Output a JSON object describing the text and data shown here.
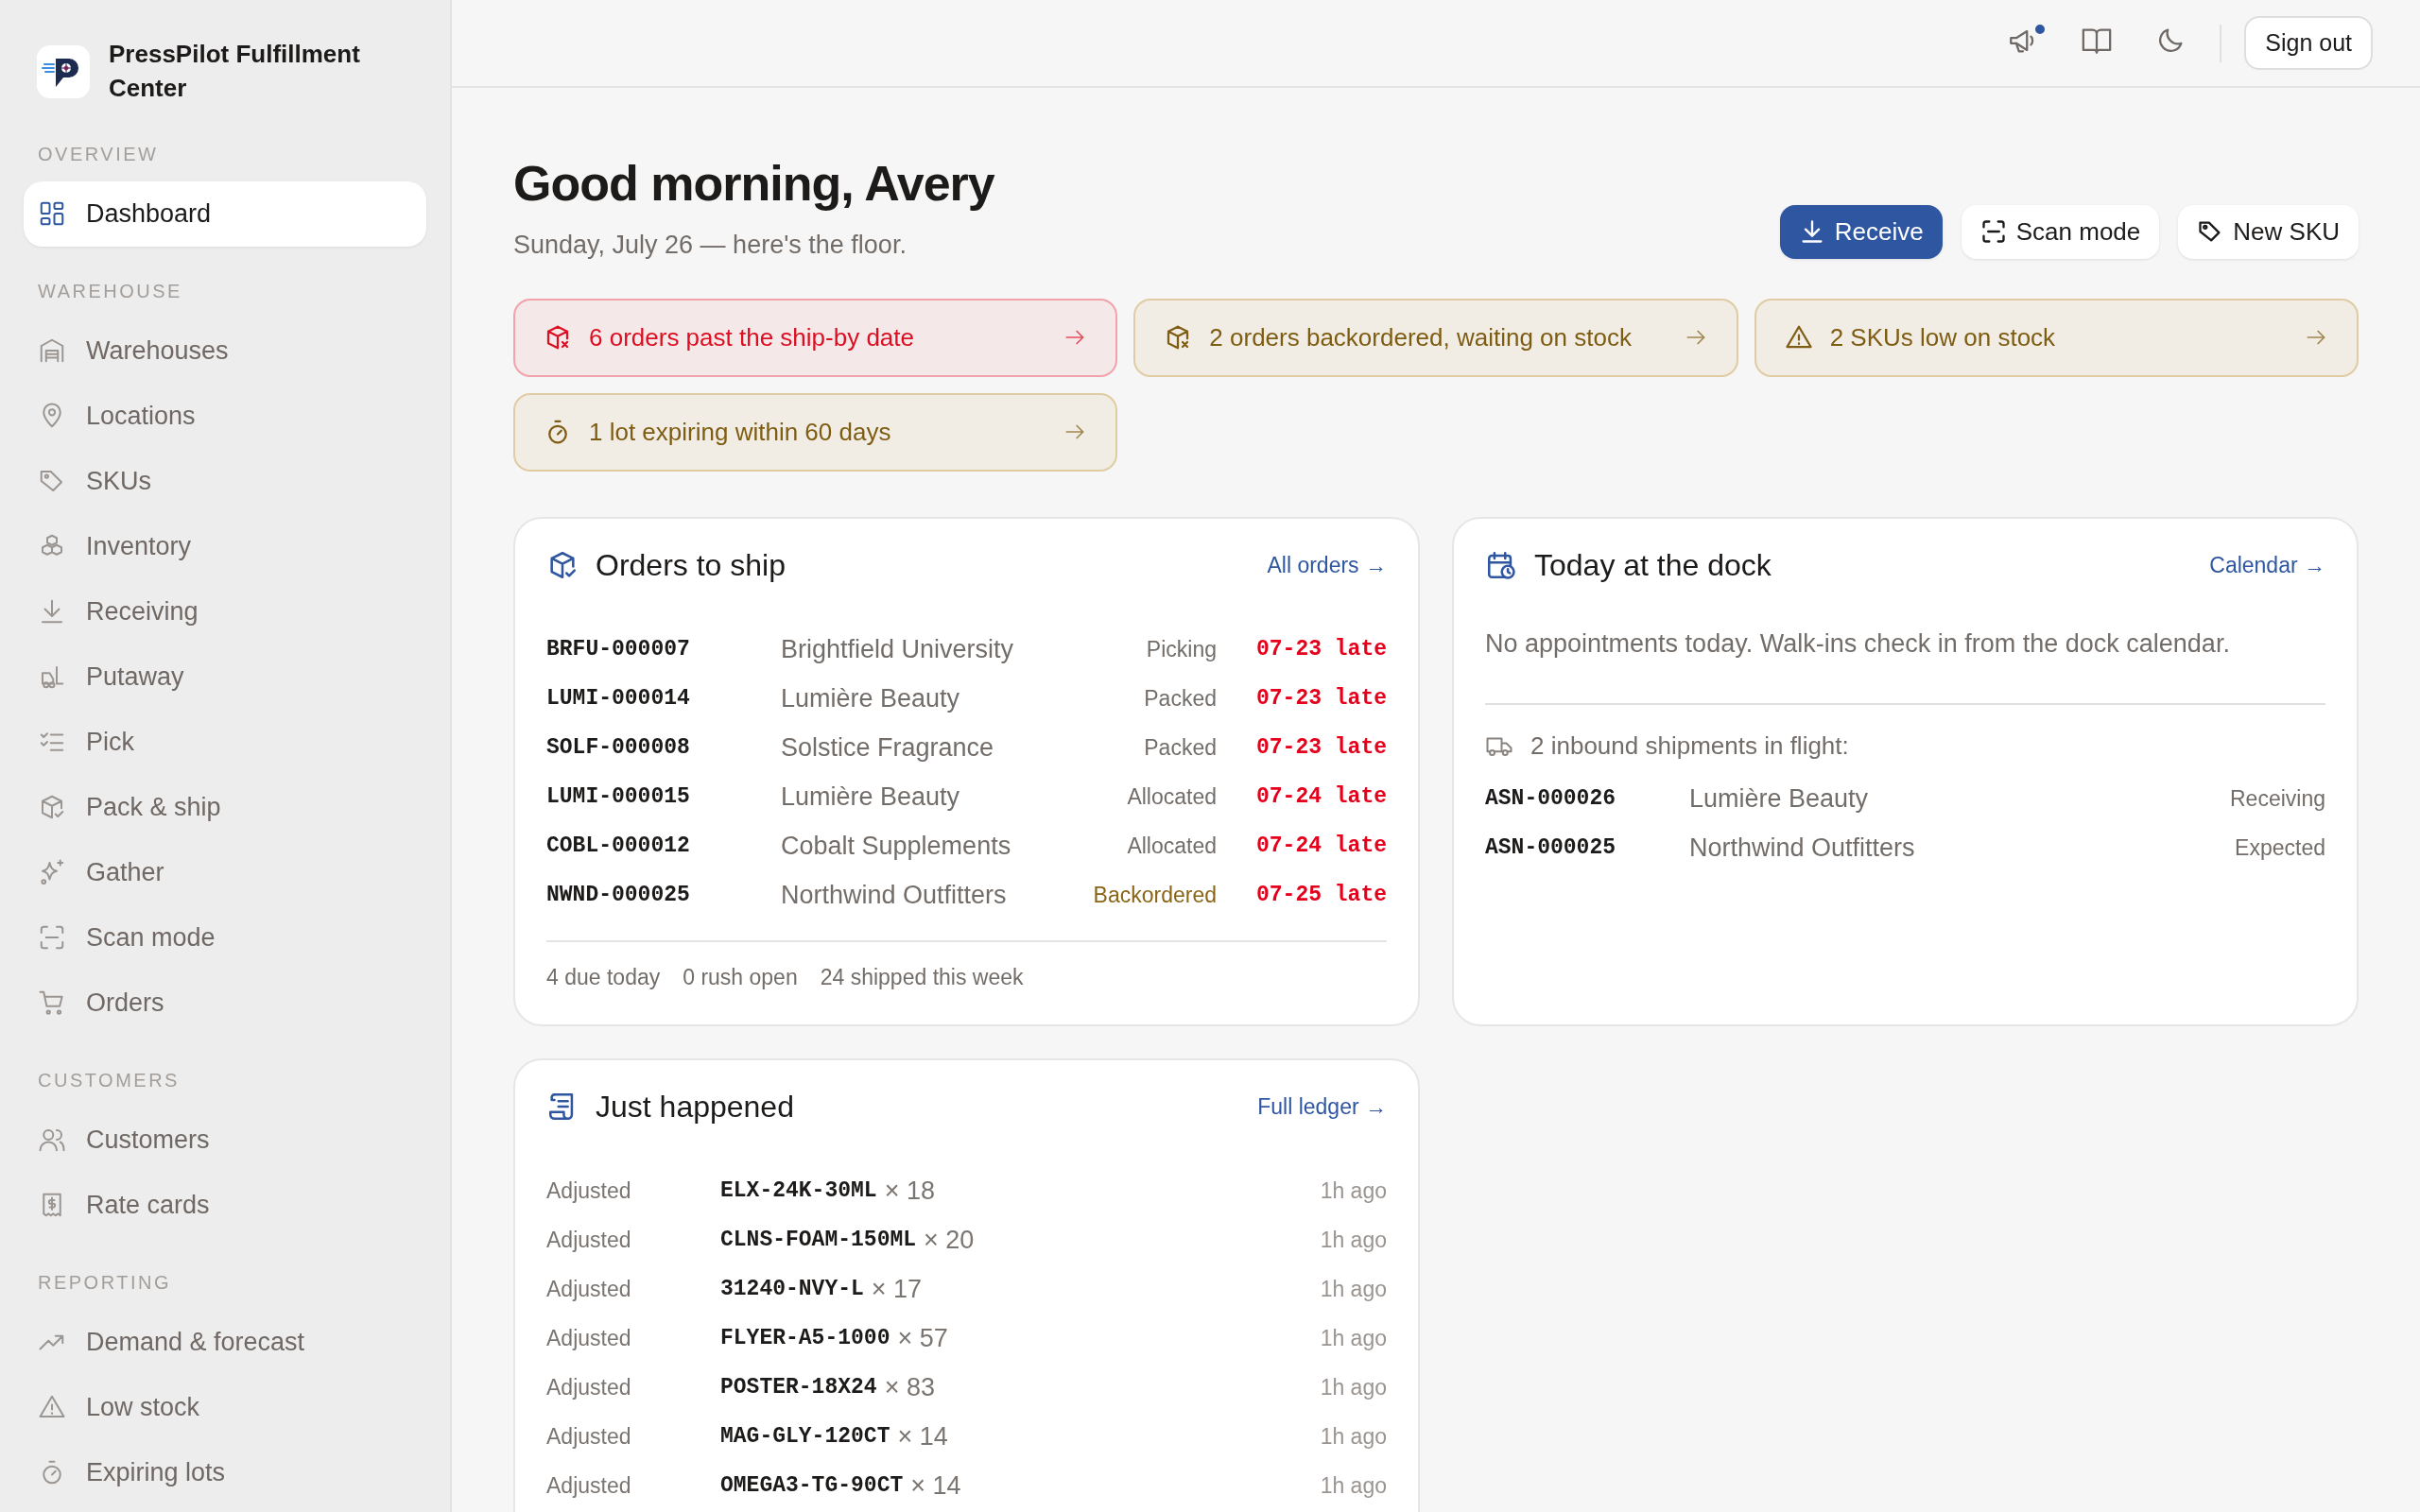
{
  "brand": {
    "name": "PressPilot Fulfillment Center"
  },
  "sidebar": {
    "sections": [
      {
        "label": "OVERVIEW",
        "items": [
          {
            "label": "Dashboard",
            "selected": true
          }
        ]
      },
      {
        "label": "WAREHOUSE",
        "items": [
          {
            "label": "Warehouses",
            "selected": false
          },
          {
            "label": "Locations",
            "selected": false
          },
          {
            "label": "SKUs",
            "selected": false
          },
          {
            "label": "Inventory",
            "selected": false
          },
          {
            "label": "Receiving",
            "selected": false
          },
          {
            "label": "Putaway",
            "selected": false
          },
          {
            "label": "Pick",
            "selected": false
          },
          {
            "label": "Pack & ship",
            "selected": false
          },
          {
            "label": "Gather",
            "selected": false
          },
          {
            "label": "Scan mode",
            "selected": false
          },
          {
            "label": "Orders",
            "selected": false
          }
        ]
      },
      {
        "label": "CUSTOMERS",
        "items": [
          {
            "label": "Customers",
            "selected": false
          },
          {
            "label": "Rate cards",
            "selected": false
          }
        ]
      },
      {
        "label": "REPORTING",
        "items": [
          {
            "label": "Demand & forecast",
            "selected": false
          },
          {
            "label": "Low stock",
            "selected": false
          },
          {
            "label": "Expiring lots",
            "selected": false
          }
        ]
      }
    ]
  },
  "topbar": {
    "announcements_unread": true,
    "sign_out": "Sign out"
  },
  "header": {
    "title": "Good morning, Avery",
    "subtitle": "Sunday, July 26 — here's the floor.",
    "actions": [
      {
        "label": "Receive",
        "primary": true
      },
      {
        "label": "Scan mode",
        "primary": false
      },
      {
        "label": "New SKU",
        "primary": false
      }
    ]
  },
  "alerts": [
    {
      "text": "6 orders past the ship-by date",
      "urgent": true
    },
    {
      "text": "2 orders backordered, waiting on stock",
      "urgent": false
    },
    {
      "text": "2 SKUs low on stock",
      "urgent": false
    },
    {
      "text": "1 lot expiring within 60 days",
      "urgent": false
    }
  ],
  "orders_to_ship": {
    "title": "Orders to ship",
    "link": "All orders →",
    "rows": [
      {
        "id": "BRFU-000007",
        "customer": "Brightfield University",
        "status": "Picking",
        "warning": false,
        "due": "07-23 late",
        "overdue": true
      },
      {
        "id": "LUMI-000014",
        "customer": "Lumière Beauty",
        "status": "Packed",
        "warning": false,
        "due": "07-23 late",
        "overdue": true
      },
      {
        "id": "SOLF-000008",
        "customer": "Solstice Fragrance",
        "status": "Packed",
        "warning": false,
        "due": "07-23 late",
        "overdue": true
      },
      {
        "id": "LUMI-000015",
        "customer": "Lumière Beauty",
        "status": "Allocated",
        "warning": false,
        "due": "07-24 late",
        "overdue": true
      },
      {
        "id": "COBL-000012",
        "customer": "Cobalt Supplements",
        "status": "Allocated",
        "warning": false,
        "due": "07-24 late",
        "overdue": true
      },
      {
        "id": "NWND-000025",
        "customer": "Northwind Outfitters",
        "status": "Backordered",
        "warning": true,
        "due": "07-25 late",
        "overdue": true
      }
    ],
    "stats": [
      "4 due today",
      "0 rush open",
      "24 shipped this week"
    ]
  },
  "dock": {
    "title": "Today at the dock",
    "link": "Calendar →",
    "empty_message": "No appointments today. Walk-ins check in from the dock calendar.",
    "inbound_label": "2 inbound shipments in flight:",
    "shipments": [
      {
        "id": "ASN-000026",
        "customer": "Lumière Beauty",
        "status": "Receiving"
      },
      {
        "id": "ASN-000025",
        "customer": "Northwind Outfitters",
        "status": "Expected"
      }
    ]
  },
  "just_happened": {
    "title": "Just happened",
    "link": "Full ledger →",
    "entries": [
      {
        "action": "Adjusted",
        "sku": "ELX-24K-30ML",
        "qty": "× 18",
        "time": "1h ago"
      },
      {
        "action": "Adjusted",
        "sku": "CLNS-FOAM-150ML",
        "qty": "× 20",
        "time": "1h ago"
      },
      {
        "action": "Adjusted",
        "sku": "31240-NVY-L",
        "qty": "× 17",
        "time": "1h ago"
      },
      {
        "action": "Adjusted",
        "sku": "FLYER-A5-1000",
        "qty": "× 57",
        "time": "1h ago"
      },
      {
        "action": "Adjusted",
        "sku": "POSTER-18X24",
        "qty": "× 83",
        "time": "1h ago"
      },
      {
        "action": "Adjusted",
        "sku": "MAG-GLY-120CT",
        "qty": "× 14",
        "time": "1h ago"
      },
      {
        "action": "Adjusted",
        "sku": "OMEGA3-TG-90CT",
        "qty": "× 14",
        "time": "1h ago"
      }
    ]
  }
}
